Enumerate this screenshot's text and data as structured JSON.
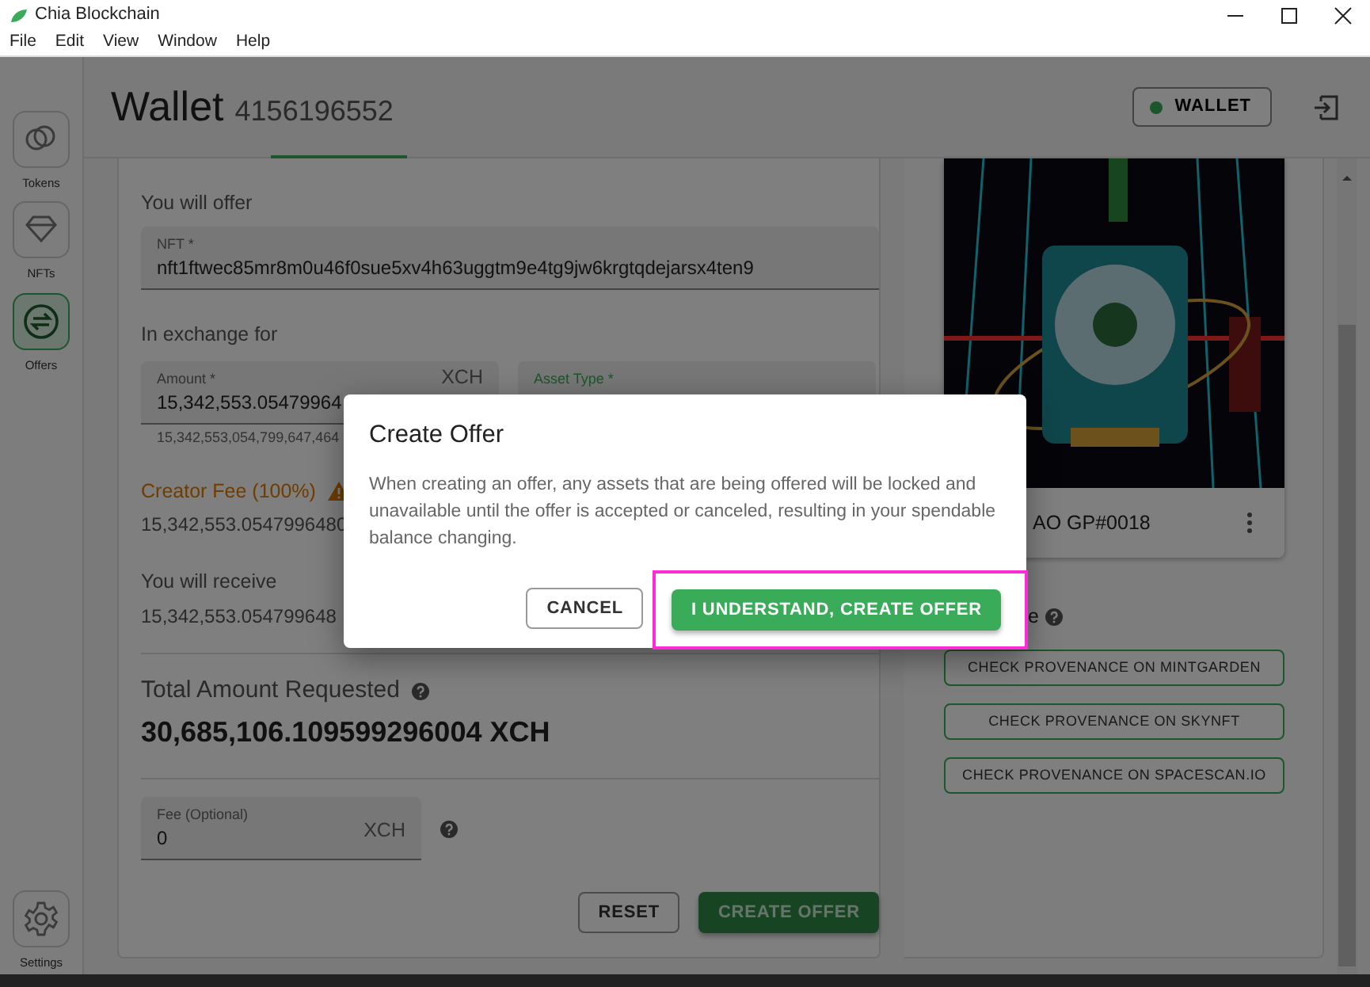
{
  "window": {
    "title": "Chia Blockchain"
  },
  "menu": [
    "File",
    "Edit",
    "View",
    "Window",
    "Help"
  ],
  "sidebar": {
    "items": [
      {
        "label": "Tokens",
        "kind": "tokens",
        "selected": false
      },
      {
        "label": "NFTs",
        "kind": "nfts",
        "selected": false
      },
      {
        "label": "Offers",
        "kind": "offers",
        "selected": true
      }
    ],
    "footer_item": {
      "label": "Settings",
      "kind": "settings"
    }
  },
  "header": {
    "title": "Wallet",
    "wallet_id": "4156196552",
    "status_button": {
      "label": "WALLET",
      "connected": true
    }
  },
  "offer_form": {
    "offer": {
      "heading": "You will offer",
      "nft_field": {
        "label": "NFT *",
        "value": "nft1ftwec85mr8m0u46f0sue5xv4h63uggtm9e4tg9jw6krgtqdejarsx4ten9"
      }
    },
    "exchange": {
      "heading": "In exchange for",
      "amount_field": {
        "label": "Amount *",
        "value": "15,342,553.05479964",
        "unit": "XCH",
        "helper": "15,342,553,054,799,647,464"
      },
      "asset_type_field": {
        "label": "Asset Type *",
        "focused": true
      }
    },
    "creator_fee": {
      "label": "Creator Fee (100%)",
      "warning": true,
      "value": "15,342,553.0547996480"
    },
    "receive": {
      "label": "You will receive",
      "value": "15,342,553.054799648"
    },
    "total": {
      "label": "Total Amount Requested",
      "value": "30,685,106.109599296004 XCH"
    },
    "fee_field": {
      "label": "Fee (Optional)",
      "value": "0",
      "unit": "XCH"
    },
    "actions": [
      {
        "label": "RESET",
        "kind": "outline"
      },
      {
        "label": "CREATE OFFER",
        "kind": "primary"
      }
    ]
  },
  "nft_panel": {
    "name": "AO GP#0018",
    "provenance_heading": "e",
    "buttons": [
      "CHECK PROVENANCE ON MINTGARDEN",
      "CHECK PROVENANCE ON SKYNFT",
      "CHECK PROVENANCE ON SPACESCAN.IO"
    ]
  },
  "dialog": {
    "title": "Create Offer",
    "body": "When creating an offer, any assets that are being offered will be locked and unavailable until the offer is accepted or canceled, resulting in your spendable balance changing.",
    "buttons": [
      {
        "label": "CANCEL",
        "kind": "outline",
        "highlighted": false
      },
      {
        "label": "I UNDERSTAND, CREATE OFFER",
        "kind": "primary",
        "highlighted": true
      }
    ]
  }
}
